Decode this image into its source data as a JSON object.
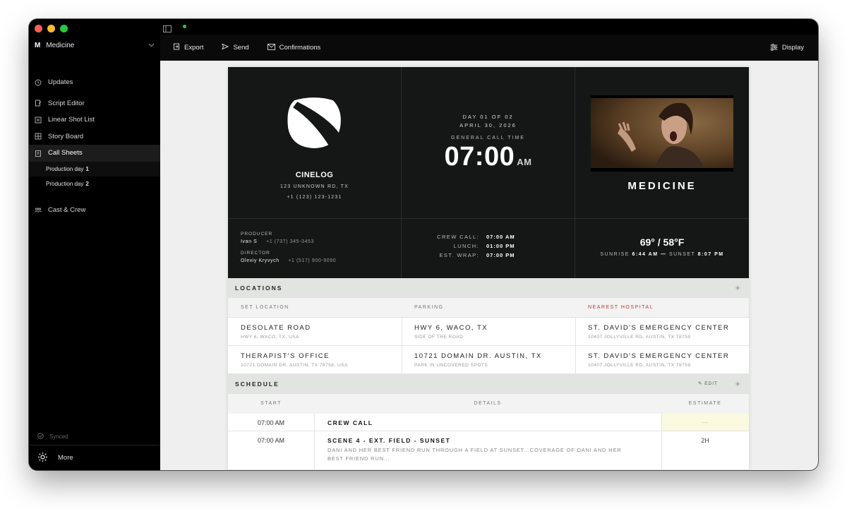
{
  "sidebar": {
    "workspace_letter": "M",
    "workspace_name": "Medicine",
    "items": [
      {
        "label": "Updates"
      },
      {
        "label": "Script Editor"
      },
      {
        "label": "Linear Shot List"
      },
      {
        "label": "Story Board"
      },
      {
        "label": "Call Sheets"
      },
      {
        "label": "Cast & Crew"
      }
    ],
    "subitems": [
      {
        "label": "Production day",
        "num": "1"
      },
      {
        "label": "Production day",
        "num": "2"
      }
    ],
    "synced": "Synced",
    "more": "More"
  },
  "toolbar": {
    "export": "Export",
    "send": "Send",
    "confirmations": "Confirmations",
    "display": "Display"
  },
  "header": {
    "company": "CINELOG",
    "address": "123 UNKNOWN RD, TX",
    "phone": "+1 (123) 123-1231",
    "producer_label": "PRODUCER",
    "producer_name": "Ivan S",
    "producer_phone": "+1 (737) 345-3453",
    "director_label": "DIRECTOR",
    "director_name": "Olexiy Kryvych",
    "director_phone": "+1 (517) 900-9090",
    "day": "DAY 01 OF 02",
    "date": "APRIL 30, 2026",
    "call_time_label": "GENERAL CALL TIME",
    "call_time": "07:00",
    "call_ampm": "AM",
    "crew_call_label": "CREW CALL:",
    "crew_call": "07:00 AM",
    "lunch_label": "LUNCH:",
    "lunch": "01:00 PM",
    "wrap_label": "EST. WRAP:",
    "wrap": "07:00 PM",
    "title": "MEDICINE",
    "temperature": "69° / 58°F",
    "sunrise_label": "SUNRISE",
    "sunrise": "6:44 AM",
    "sep": "—",
    "sunset_label": "SUNSET",
    "sunset": "8:07 PM"
  },
  "locations": {
    "title": "LOCATIONS",
    "plus": "+",
    "headers": {
      "set": "SET LOCATION",
      "parking": "PARKING",
      "hospital": "NEAREST HOSPITAL"
    },
    "rows": [
      {
        "set": "DESOLATE ROAD",
        "set_sub": "HWY 6, WACO, TX, USA",
        "parking": "HWY 6, WACO, TX",
        "parking_sub": "SIDE OF THE ROAD",
        "hospital": "ST. DAVID'S EMERGENCY CENTER",
        "hospital_sub": "10407 JOLLYVILLE RD, AUSTIN, TX 78759"
      },
      {
        "set": "THERAPIST'S OFFICE",
        "set_sub": "10721 DOMAIN DR, AUSTIN, TX 78758, USA",
        "parking": "10721 DOMAIN DR. AUSTIN, TX",
        "parking_sub": "PARK IN UNCOVERED SPOTS",
        "hospital": "ST. DAVID'S EMERGENCY CENTER",
        "hospital_sub": "10407 JOLLYVILLE RD, AUSTIN, TX 78759"
      }
    ]
  },
  "schedule": {
    "title": "SCHEDULE",
    "edit": "EDIT",
    "plus": "+",
    "headers": {
      "start": "START",
      "details": "DETAILS",
      "estimate": "ESTIMATE"
    },
    "rows": [
      {
        "start": "07:00 AM",
        "title": "CREW CALL",
        "desc": "",
        "estimate": "—"
      },
      {
        "start": "07:00 AM",
        "title": "SCENE 4 - EXT. FIELD - SUNSET",
        "desc": "DANI AND HER BEST FRIEND RUN THROUGH A FIELD AT SUNSET.. COVERAGE OF DANI AND HER BEST FRIEND RUN...",
        "estimate": "2H"
      }
    ]
  },
  "colors": {
    "hospital_header": "#c0392b",
    "traffic_red": "#ff5f57",
    "traffic_yellow": "#febc2e",
    "traffic_green": "#28c840",
    "estimate_highlight": "#fbf9df"
  }
}
